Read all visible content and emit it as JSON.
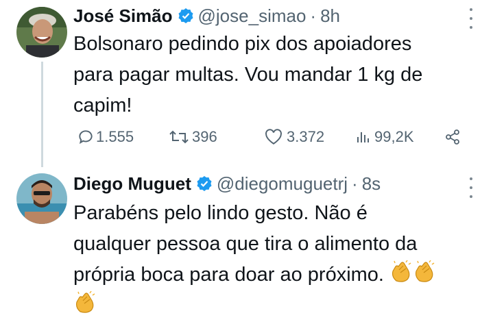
{
  "tweets": [
    {
      "name": "José Simão",
      "handle": "@jose_simao",
      "separator": "·",
      "time": "8h",
      "lines": [
        "Bolsonaro pedindo pix dos apoiadores",
        "para pagar multas. Vou mandar 1 kg de",
        "capim!"
      ],
      "stats": {
        "replies": "1.555",
        "retweets": "396",
        "likes": "3.372",
        "views": "99,2K"
      }
    },
    {
      "name": "Diego Muguet",
      "handle": "@diegomuguetrj",
      "separator": "·",
      "time": "8s",
      "lines": [
        "Parabéns pelo lindo gesto. Não é",
        "qualquer pessoa que tira o alimento da",
        "própria boca para doar ao próximo."
      ]
    }
  ],
  "colors": {
    "verified": "#1d9bf0",
    "muted_text": "#536471",
    "thread_line": "#cfd9de"
  }
}
